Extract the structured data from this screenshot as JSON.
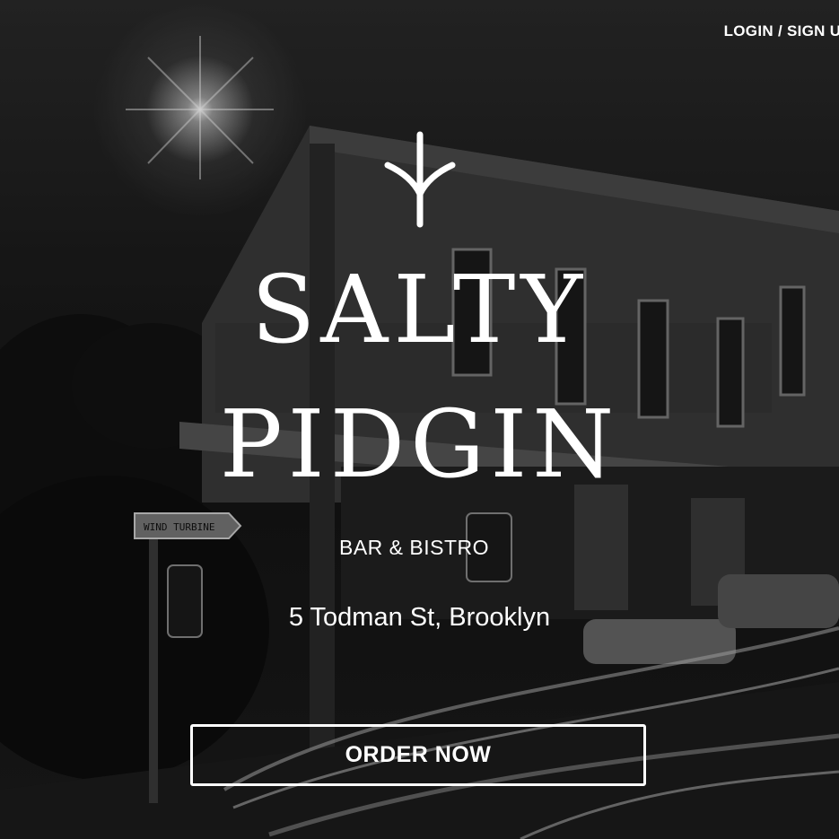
{
  "header": {
    "login_label": "LOGIN / SIGN UP"
  },
  "hero": {
    "logo_icon": "bird-foot-icon",
    "title_line1": "SALTY",
    "title_line2": "PIDGIN",
    "subtitle": "BAR & BISTRO",
    "address": "5 Todman St, Brooklyn",
    "cta_label": "ORDER NOW"
  },
  "background": {
    "description_colors": [
      "#141414",
      "#2a2a2a",
      "#ffffff"
    ],
    "street_sign_text": "WIND TURBINE"
  }
}
